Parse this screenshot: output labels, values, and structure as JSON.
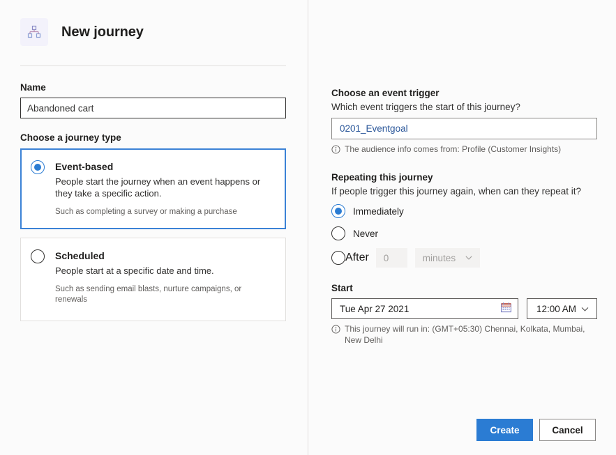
{
  "header": {
    "icon": "hierarchy-icon",
    "title": "New journey"
  },
  "left": {
    "name_label": "Name",
    "name_value": "Abandoned cart",
    "journey_type_label": "Choose a journey type",
    "types": [
      {
        "title": "Event-based",
        "description": "People start the journey when an event happens or they take a specific action.",
        "hint": "Such as completing a survey or making a purchase",
        "selected": true
      },
      {
        "title": "Scheduled",
        "description": "People start at a specific date and time.",
        "hint": "Such as sending email blasts, nurture campaigns, or renewals",
        "selected": false
      }
    ]
  },
  "right": {
    "trigger": {
      "heading": "Choose an event trigger",
      "subheading": "Which event triggers the start of this journey?",
      "value": "0201_Eventgoal",
      "info": "The audience info comes from: Profile (Customer Insights)"
    },
    "repeat": {
      "heading": "Repeating this journey",
      "subheading": "If people trigger this journey again, when can they repeat it?",
      "options": [
        {
          "label": "Immediately",
          "selected": true
        },
        {
          "label": "Never",
          "selected": false
        },
        {
          "label": "After",
          "selected": false
        }
      ],
      "after_amount": "0",
      "after_unit": "minutes"
    },
    "start": {
      "label": "Start",
      "date": "Tue Apr 27 2021",
      "time": "12:00 AM",
      "info": "This journey will run in: (GMT+05:30) Chennai, Kolkata, Mumbai, New Delhi"
    }
  },
  "footer": {
    "create_label": "Create",
    "cancel_label": "Cancel"
  },
  "colors": {
    "accent": "#2b7cd3",
    "selected_card_border": "#3b82d6",
    "link": "#2b579a",
    "disabled_bg": "#f3f2f1",
    "divider": "#e1dfdd"
  }
}
